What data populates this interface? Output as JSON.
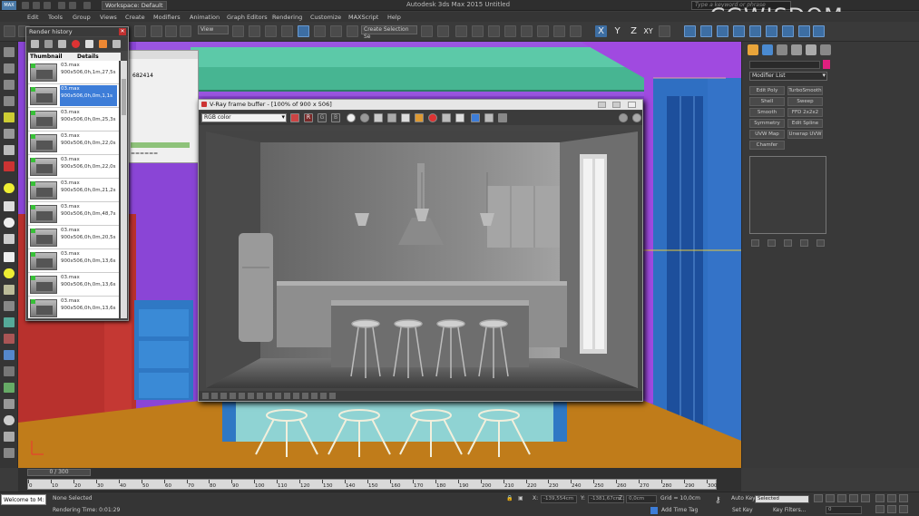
{
  "titlebar": {
    "workspace": "Workspace: Default",
    "app_title": "Autodesk 3ds Max 2015     Untitled",
    "search_placeholder": "Type a keyword or phrase",
    "watermark": "CGWISDOM"
  },
  "menu": [
    "Edit",
    "Tools",
    "Group",
    "Views",
    "Create",
    "Modifiers",
    "Animation",
    "Graph Editors",
    "Rendering",
    "Customize",
    "MAXScript",
    "Help"
  ],
  "toolbar": {
    "view_dropdown": "View",
    "selection_set_placeholder": "Create Selection Se",
    "axes": [
      "X",
      "Y",
      "Z",
      "XY"
    ]
  },
  "render_history": {
    "title": "Render history",
    "col_thumbnail": "Thumbnail",
    "col_details": "Details",
    "items": [
      {
        "file": "03.max",
        "info": "900x506,0h,1m,27,5s",
        "selected": false
      },
      {
        "file": "03.max",
        "info": "900x506,0h,0m,1,1s",
        "selected": true
      },
      {
        "file": "03.max",
        "info": "900x506,0h,0m,25,3s",
        "selected": false
      },
      {
        "file": "03.max",
        "info": "900x506,0h,0m,22,0s",
        "selected": false
      },
      {
        "file": "03.max",
        "info": "900x506,0h,0m,22,0s",
        "selected": false
      },
      {
        "file": "03.max",
        "info": "900x506,0h,0m,21,2s",
        "selected": false
      },
      {
        "file": "03.max",
        "info": "900x506,0h,0m,48,7s",
        "selected": false
      },
      {
        "file": "03.max",
        "info": "900x506,0h,0m,20,5s",
        "selected": false
      },
      {
        "file": "03.max",
        "info": "900x506,0h,0m,13,6s",
        "selected": false
      },
      {
        "file": "03.max",
        "info": "900x506,0h,0m,13,6s",
        "selected": false
      },
      {
        "file": "03.max",
        "info": "900x506,0h,0m,13,6s",
        "selected": false
      }
    ]
  },
  "maxscript_window": {
    "number": "682414",
    "dots": "======"
  },
  "vfb": {
    "title": "V-Ray frame buffer - [100% of 900 x 506]",
    "channel": "RGB color",
    "channel_buttons": [
      "R",
      "G",
      "B"
    ]
  },
  "command_panel": {
    "modifier_list": "Modifier List",
    "buttons": [
      "Edit Poly",
      "TurboSmooth",
      "Shell",
      "Sweep",
      "Smooth",
      "FFD 2x2x2",
      "Symmetry",
      "Edit Spline",
      "UVW Map",
      "Unwrap UVW",
      "Chamfer"
    ]
  },
  "timeline": {
    "slider": "0 / 300",
    "ticks": [
      "0",
      "10",
      "20",
      "30",
      "40",
      "50",
      "60",
      "70",
      "80",
      "90",
      "100",
      "110",
      "120",
      "130",
      "140",
      "150",
      "160",
      "170",
      "180",
      "190",
      "200",
      "210",
      "220",
      "230",
      "240",
      "250",
      "260",
      "270",
      "280",
      "290",
      "300"
    ]
  },
  "status": {
    "maxscript": "Welcome to M:",
    "selection": "None Selected",
    "rendering_time": "Rendering Time: 0:01:29",
    "x_label": "X:",
    "x_value": "-139,554cm",
    "y_label": "Y:",
    "y_value": "-1381,67cm",
    "z_label": "Z:",
    "z_value": "0,0cm",
    "grid": "Grid = 10,0cm",
    "add_time_tag": "Add Time Tag",
    "auto_key": "Auto Key",
    "set_key": "Set Key",
    "selected_dropdown": "Selected",
    "key_filters": "Key Filters...",
    "frame_value": "0"
  }
}
